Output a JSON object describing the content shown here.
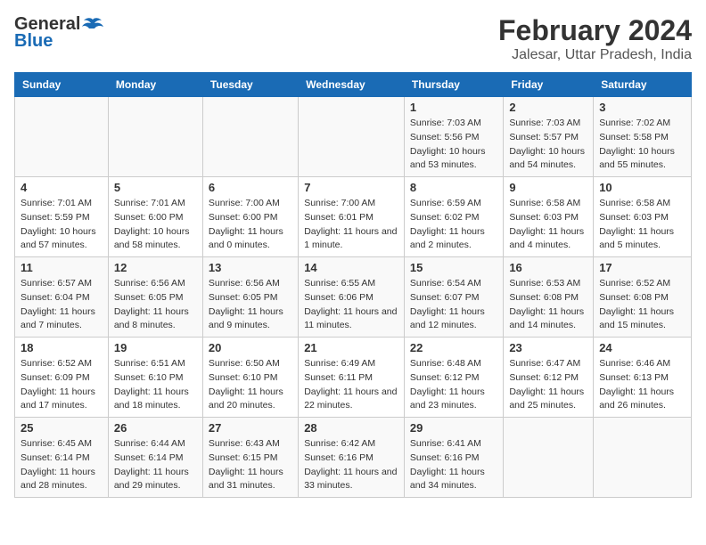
{
  "logo": {
    "general": "General",
    "blue": "Blue"
  },
  "title": {
    "month_year": "February 2024",
    "location": "Jalesar, Uttar Pradesh, India"
  },
  "weekdays": [
    "Sunday",
    "Monday",
    "Tuesday",
    "Wednesday",
    "Thursday",
    "Friday",
    "Saturday"
  ],
  "weeks": [
    [
      {
        "day": "",
        "info": ""
      },
      {
        "day": "",
        "info": ""
      },
      {
        "day": "",
        "info": ""
      },
      {
        "day": "",
        "info": ""
      },
      {
        "day": "1",
        "sunrise": "Sunrise: 7:03 AM",
        "sunset": "Sunset: 5:56 PM",
        "daylight": "Daylight: 10 hours and 53 minutes."
      },
      {
        "day": "2",
        "sunrise": "Sunrise: 7:03 AM",
        "sunset": "Sunset: 5:57 PM",
        "daylight": "Daylight: 10 hours and 54 minutes."
      },
      {
        "day": "3",
        "sunrise": "Sunrise: 7:02 AM",
        "sunset": "Sunset: 5:58 PM",
        "daylight": "Daylight: 10 hours and 55 minutes."
      }
    ],
    [
      {
        "day": "4",
        "sunrise": "Sunrise: 7:01 AM",
        "sunset": "Sunset: 5:59 PM",
        "daylight": "Daylight: 10 hours and 57 minutes."
      },
      {
        "day": "5",
        "sunrise": "Sunrise: 7:01 AM",
        "sunset": "Sunset: 6:00 PM",
        "daylight": "Daylight: 10 hours and 58 minutes."
      },
      {
        "day": "6",
        "sunrise": "Sunrise: 7:00 AM",
        "sunset": "Sunset: 6:00 PM",
        "daylight": "Daylight: 11 hours and 0 minutes."
      },
      {
        "day": "7",
        "sunrise": "Sunrise: 7:00 AM",
        "sunset": "Sunset: 6:01 PM",
        "daylight": "Daylight: 11 hours and 1 minute."
      },
      {
        "day": "8",
        "sunrise": "Sunrise: 6:59 AM",
        "sunset": "Sunset: 6:02 PM",
        "daylight": "Daylight: 11 hours and 2 minutes."
      },
      {
        "day": "9",
        "sunrise": "Sunrise: 6:58 AM",
        "sunset": "Sunset: 6:03 PM",
        "daylight": "Daylight: 11 hours and 4 minutes."
      },
      {
        "day": "10",
        "sunrise": "Sunrise: 6:58 AM",
        "sunset": "Sunset: 6:03 PM",
        "daylight": "Daylight: 11 hours and 5 minutes."
      }
    ],
    [
      {
        "day": "11",
        "sunrise": "Sunrise: 6:57 AM",
        "sunset": "Sunset: 6:04 PM",
        "daylight": "Daylight: 11 hours and 7 minutes."
      },
      {
        "day": "12",
        "sunrise": "Sunrise: 6:56 AM",
        "sunset": "Sunset: 6:05 PM",
        "daylight": "Daylight: 11 hours and 8 minutes."
      },
      {
        "day": "13",
        "sunrise": "Sunrise: 6:56 AM",
        "sunset": "Sunset: 6:05 PM",
        "daylight": "Daylight: 11 hours and 9 minutes."
      },
      {
        "day": "14",
        "sunrise": "Sunrise: 6:55 AM",
        "sunset": "Sunset: 6:06 PM",
        "daylight": "Daylight: 11 hours and 11 minutes."
      },
      {
        "day": "15",
        "sunrise": "Sunrise: 6:54 AM",
        "sunset": "Sunset: 6:07 PM",
        "daylight": "Daylight: 11 hours and 12 minutes."
      },
      {
        "day": "16",
        "sunrise": "Sunrise: 6:53 AM",
        "sunset": "Sunset: 6:08 PM",
        "daylight": "Daylight: 11 hours and 14 minutes."
      },
      {
        "day": "17",
        "sunrise": "Sunrise: 6:52 AM",
        "sunset": "Sunset: 6:08 PM",
        "daylight": "Daylight: 11 hours and 15 minutes."
      }
    ],
    [
      {
        "day": "18",
        "sunrise": "Sunrise: 6:52 AM",
        "sunset": "Sunset: 6:09 PM",
        "daylight": "Daylight: 11 hours and 17 minutes."
      },
      {
        "day": "19",
        "sunrise": "Sunrise: 6:51 AM",
        "sunset": "Sunset: 6:10 PM",
        "daylight": "Daylight: 11 hours and 18 minutes."
      },
      {
        "day": "20",
        "sunrise": "Sunrise: 6:50 AM",
        "sunset": "Sunset: 6:10 PM",
        "daylight": "Daylight: 11 hours and 20 minutes."
      },
      {
        "day": "21",
        "sunrise": "Sunrise: 6:49 AM",
        "sunset": "Sunset: 6:11 PM",
        "daylight": "Daylight: 11 hours and 22 minutes."
      },
      {
        "day": "22",
        "sunrise": "Sunrise: 6:48 AM",
        "sunset": "Sunset: 6:12 PM",
        "daylight": "Daylight: 11 hours and 23 minutes."
      },
      {
        "day": "23",
        "sunrise": "Sunrise: 6:47 AM",
        "sunset": "Sunset: 6:12 PM",
        "daylight": "Daylight: 11 hours and 25 minutes."
      },
      {
        "day": "24",
        "sunrise": "Sunrise: 6:46 AM",
        "sunset": "Sunset: 6:13 PM",
        "daylight": "Daylight: 11 hours and 26 minutes."
      }
    ],
    [
      {
        "day": "25",
        "sunrise": "Sunrise: 6:45 AM",
        "sunset": "Sunset: 6:14 PM",
        "daylight": "Daylight: 11 hours and 28 minutes."
      },
      {
        "day": "26",
        "sunrise": "Sunrise: 6:44 AM",
        "sunset": "Sunset: 6:14 PM",
        "daylight": "Daylight: 11 hours and 29 minutes."
      },
      {
        "day": "27",
        "sunrise": "Sunrise: 6:43 AM",
        "sunset": "Sunset: 6:15 PM",
        "daylight": "Daylight: 11 hours and 31 minutes."
      },
      {
        "day": "28",
        "sunrise": "Sunrise: 6:42 AM",
        "sunset": "Sunset: 6:16 PM",
        "daylight": "Daylight: 11 hours and 33 minutes."
      },
      {
        "day": "29",
        "sunrise": "Sunrise: 6:41 AM",
        "sunset": "Sunset: 6:16 PM",
        "daylight": "Daylight: 11 hours and 34 minutes."
      },
      {
        "day": "",
        "info": ""
      },
      {
        "day": "",
        "info": ""
      }
    ]
  ]
}
